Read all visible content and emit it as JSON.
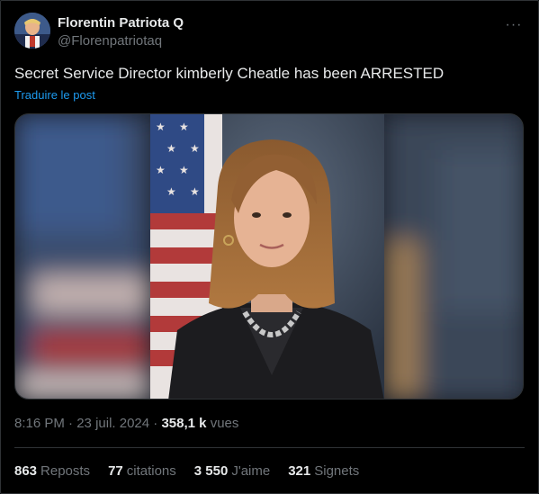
{
  "author": {
    "display_name": "Florentin Patriota Q",
    "handle": "@Florenpatriotaq"
  },
  "post": {
    "text": "Secret Service Director kimberly Cheatle has been ARRESTED",
    "translate_label": "Traduire le post",
    "more_label": "···"
  },
  "meta": {
    "time": "8:16 PM",
    "date": "23 juil. 2024",
    "separator": "·",
    "views_count": "358,1 k",
    "views_label": "vues"
  },
  "stats": [
    {
      "count": "863",
      "label": "Reposts"
    },
    {
      "count": "77",
      "label": "citations"
    },
    {
      "count": "3 550",
      "label": "J'aime"
    },
    {
      "count": "321",
      "label": "Signets"
    }
  ],
  "colors": {
    "background": "#000000",
    "text": "#e7e9ea",
    "muted": "#71767b",
    "link": "#1d9bf0",
    "border": "#2f3336"
  }
}
